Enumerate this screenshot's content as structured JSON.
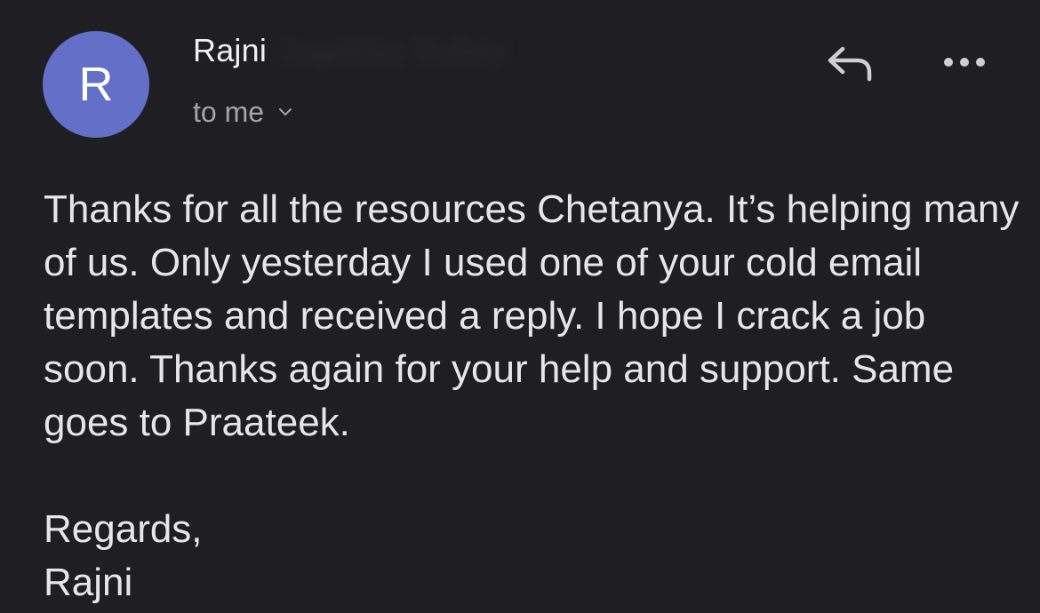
{
  "sender": {
    "avatar_initial": "R",
    "avatar_color": "#6470c8",
    "name": "Rajni",
    "redacted_surname": "Jugaldas Dubey"
  },
  "recipient": {
    "label": "to me",
    "expand_icon": "chevron-down-icon"
  },
  "actions": {
    "reply_icon": "reply-icon",
    "more_icon": "more-horizontal-icon"
  },
  "message": {
    "body": "Thanks for all the resources Chetanya. It’s helping many of us. Only yesterday I used one of your cold email templates and received a reply. I hope I crack a job soon. Thanks again for your help and support. Same goes to Praateek.",
    "closing": "Regards,",
    "signature": "Rajni"
  },
  "colors": {
    "background": "#1f1f23",
    "text": "#e6e6e8",
    "muted": "#a4a4aa"
  }
}
